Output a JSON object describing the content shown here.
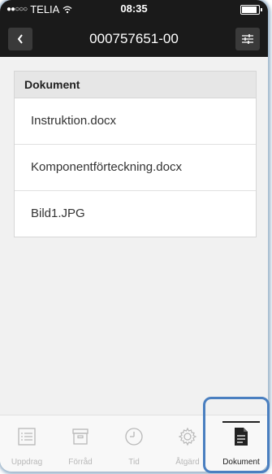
{
  "status_bar": {
    "carrier": "TELIA",
    "time": "08:35"
  },
  "navbar": {
    "title": "000757651-00"
  },
  "documents": {
    "header": "Dokument",
    "items": [
      {
        "name": "Instruktion.docx"
      },
      {
        "name": "Komponentförteckning.docx"
      },
      {
        "name": "Bild1.JPG"
      }
    ]
  },
  "tabbar": {
    "tabs": [
      {
        "label": "Uppdrag",
        "icon": "list-icon"
      },
      {
        "label": "Förråd",
        "icon": "archive-icon"
      },
      {
        "label": "Tid",
        "icon": "clock-icon"
      },
      {
        "label": "Åtgärd",
        "icon": "gear-icon"
      },
      {
        "label": "Dokument",
        "icon": "document-icon",
        "active": true
      }
    ]
  },
  "colors": {
    "topbar": "#1a1a1a",
    "accent_highlight": "#4a7fc0",
    "inactive_tab": "#b8b8b8"
  }
}
